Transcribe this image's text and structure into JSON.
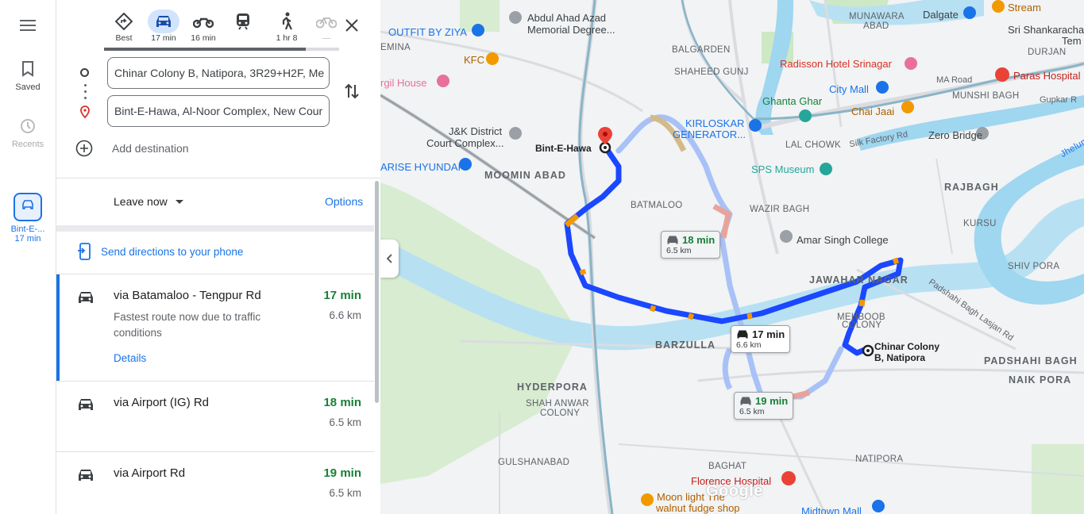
{
  "rail": {
    "saved_label": "Saved",
    "recents_label": "Recents",
    "recent_trip_label": "Bint-E-...",
    "recent_trip_time": "17 min"
  },
  "modes": [
    {
      "id": "best",
      "label": "Best",
      "icon": "diamond-directions-icon"
    },
    {
      "id": "driving",
      "label": "17 min",
      "icon": "car-icon",
      "active": true
    },
    {
      "id": "motorcycle",
      "label": "16 min",
      "icon": "motorcycle-icon"
    },
    {
      "id": "transit",
      "label": "",
      "icon": "train-icon"
    },
    {
      "id": "walking",
      "label": "1 hr 8",
      "icon": "walk-icon"
    },
    {
      "id": "cycling",
      "label": "—",
      "icon": "bike-icon",
      "disabled": true
    }
  ],
  "origin": {
    "value": "Chinar Colony B, Natipora, 3R29+H2F, Me"
  },
  "destination": {
    "value": "Bint-E-Hawa, Al-Noor Complex, New Cour"
  },
  "add_destination": "Add destination",
  "leave_now": "Leave now",
  "options": "Options",
  "send_to_phone": "Send directions to your phone",
  "routes": [
    {
      "title": "via Batamaloo - Tengpur Rd",
      "desc": "Fastest route now due to traffic conditions",
      "details": "Details",
      "time": "17 min",
      "distance": "6.6 km",
      "selected": true
    },
    {
      "title": "via Airport (IG) Rd",
      "desc": "",
      "details": "",
      "time": "18 min",
      "distance": "6.5 km"
    },
    {
      "title": "via Airport Rd",
      "desc": "",
      "details": "",
      "time": "19 min",
      "distance": "6.5 km"
    }
  ],
  "map": {
    "colors": {
      "route": "#1a47ff",
      "route_alt": "#a8c1f7",
      "traffic_slow": "#f29900",
      "water": "#9fd6f0",
      "park": "#cde8c4"
    },
    "route_badges": {
      "main": {
        "time": "17 min",
        "distance": "6.6 km"
      },
      "alt1": {
        "time": "18 min",
        "distance": "6.5 km"
      },
      "alt2": {
        "time": "19 min",
        "distance": "6.5 km"
      }
    },
    "labels": {
      "outfit": "OUTFIT BY ZIYA",
      "abdul": "Abdul Ahad Azad",
      "abdul2": "Memorial Degree...",
      "emina": "EMINA",
      "kfc": "KFC",
      "kargil": "rgil House",
      "bal": "BALGARDEN",
      "shaheed": "SHAHEED GUNJ",
      "munawara": "MUNAWARA",
      "abad": "ABAD",
      "dalgate": "Dalgate",
      "stream": "Stream",
      "sri": "Sri Shankaracha",
      "tem": "Tem",
      "durjan": "DURJAN",
      "radisson": "Radisson Hotel Srinagar",
      "paras": "Paras Hospital",
      "ma_road": "MA Road",
      "gupkar": "Gupkar R",
      "city_mall": "City Mall",
      "munshi": "MUNSHI BAGH",
      "ghanta": "Ghanta Ghar",
      "chai": "Chai Jaai",
      "jk1": "J&K District",
      "jk2": "Court Complex...",
      "kirloskar1": "KIRLOSKAR",
      "kirloskar2": "GENERATOR...",
      "lal": "LAL CHOWK",
      "silk": "Silk Factory Rd",
      "zero": "Zero Bridge",
      "jhelum": "Jhelum",
      "bint": "Bint-E-Hawa",
      "arise": "ARISE HYUNDAI",
      "moomin": "MOOMIN ABAD",
      "sps": "SPS Museum",
      "rajbagh": "RAJBAGH",
      "kursu": "KURSU",
      "batmaloo": "BATMALOO",
      "wazir": "WAZIR BAGH",
      "amar": "Amar Singh College",
      "shivpora": "SHIV PORA",
      "jawahar": "JAWAHAR NAGAR",
      "padshahi_rd": "Padshahi Bagh Lasjan Rd",
      "mehboob1": "MEHBOOB",
      "mehboob2": "COLONY",
      "chinar1": "Chinar Colony",
      "chinar2": "B, Natipora",
      "barzulla": "BARZULLA",
      "padshahi": "PADSHAHI BAGH",
      "naikpora": "NAIK PORA",
      "hyderpora": "HYDERPORA",
      "shah1": "SHAH ANWAR",
      "shah2": "COLONY",
      "gulshan": "GULSHANABAD",
      "baghat": "BAGHAT",
      "natipora": "NATIPORA",
      "florence": "Florence Hospital",
      "moon1": "Moon light The",
      "moon2": "walnut fudge shop",
      "midtown": "Midtown Mall",
      "google": "Google"
    }
  }
}
